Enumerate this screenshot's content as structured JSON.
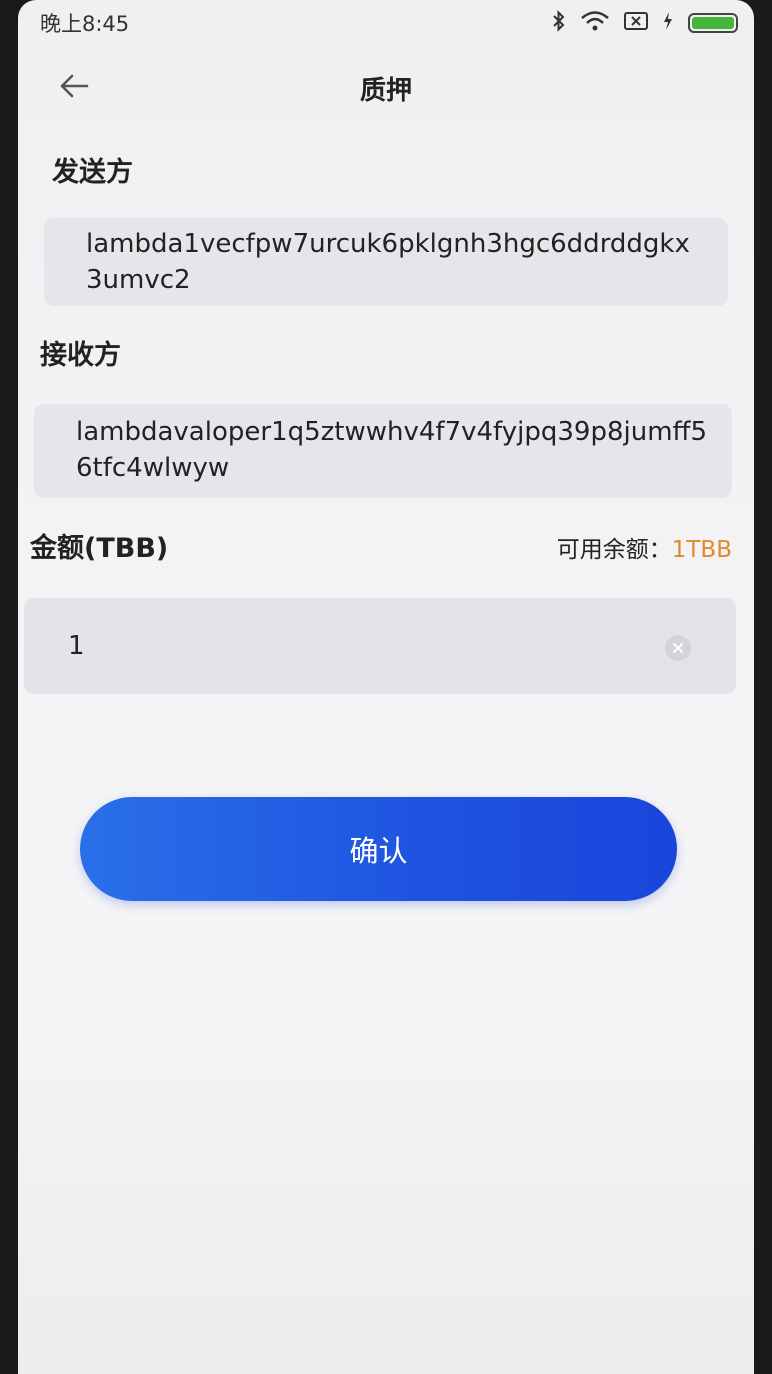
{
  "status_bar": {
    "time": "晚上8:45",
    "icons": [
      "bluetooth-icon",
      "wifi-icon",
      "sim-icon",
      "charging-icon",
      "battery-icon"
    ],
    "battery_color": "#47b53b"
  },
  "nav": {
    "title": "质押",
    "back_icon": "arrow-left-icon"
  },
  "sender": {
    "label": "发送方",
    "address": "lambda1vecfpw7urcuk6pklgnh3hgc6ddrddgkx3umvc2"
  },
  "receiver": {
    "label": "接收方",
    "address": "lambdavaloper1q5ztwwhv4f7v4fyjpq39p8jumff56tfc4wlwyw"
  },
  "amount": {
    "label": "金额(TBB)",
    "balance_label": "可用余额：",
    "balance_value": "1TBB",
    "balance_color": "#e08a2b",
    "value": "1",
    "clear_icon": "clear-icon"
  },
  "confirm": {
    "label": "确认",
    "color": "#1e52e0"
  }
}
